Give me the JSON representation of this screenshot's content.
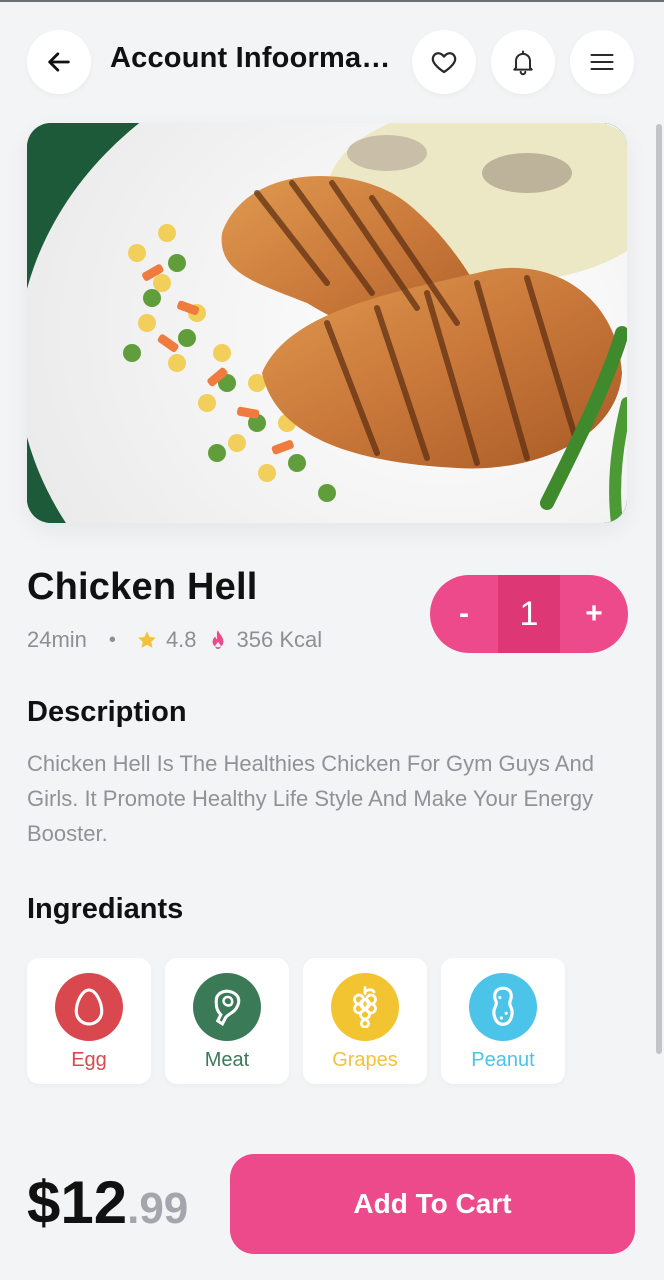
{
  "header": {
    "title": "Account Infoormation",
    "back_icon": "arrow-left-icon",
    "favorite_icon": "heart-icon",
    "notification_icon": "bell-icon",
    "menu_icon": "hamburger-menu-icon"
  },
  "product": {
    "name": "Chicken Hell",
    "time": "24min",
    "separator": "•",
    "rating": "4.8",
    "calories": "356 Kcal",
    "quantity": {
      "minus_label": "-",
      "value": "1",
      "plus_label": "+"
    }
  },
  "description": {
    "heading": "Description",
    "text": "Chicken Hell Is The Healthies Chicken For Gym Guys And Girls. It Promote Healthy Life Style And Make Your Energy Booster."
  },
  "ingredients": {
    "heading": "Ingrediants",
    "items": [
      {
        "label": "Egg",
        "icon": "egg-icon",
        "color": "#d9484f"
      },
      {
        "label": "Meat",
        "icon": "meat-icon",
        "color": "#3b7a57"
      },
      {
        "label": "Grapes",
        "icon": "grapes-icon",
        "color": "#f3c432"
      },
      {
        "label": "Peanut",
        "icon": "peanut-icon",
        "color": "#4cc3e8"
      }
    ]
  },
  "footer": {
    "price_main": "$12",
    "price_cents": ".99",
    "cart_label": "Add To Cart"
  },
  "colors": {
    "accent": "#ec4a8a",
    "accent_dark": "#dd3776",
    "background": "#f3f4f6",
    "star": "#f4c23a"
  }
}
